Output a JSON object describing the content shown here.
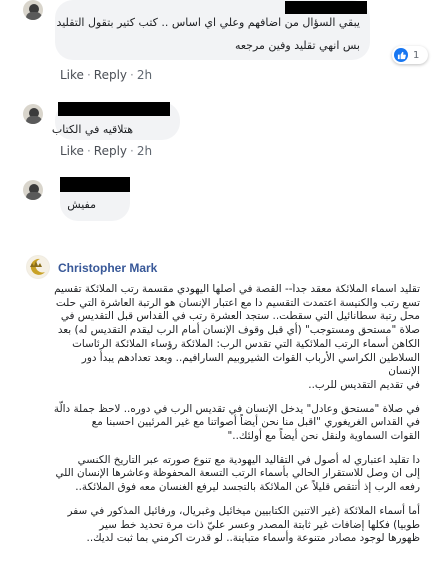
{
  "comments": [
    {
      "author_redacted": true,
      "lines": [
        "يبقي السؤال من اضافهم وعلي اي اساس .. كتب كتير بتقول التقليد",
        "بس انهي تقليد وفين مرجعه"
      ],
      "reaction_count": "1",
      "like": "Like",
      "reply": "Reply",
      "time": "2h"
    },
    {
      "author_redacted": true,
      "lines": [
        "هتلاقيه في الكتاب"
      ],
      "like": "Like",
      "reply": "Reply",
      "time": "2h"
    },
    {
      "author_redacted": true,
      "lines": [
        "مفيش"
      ]
    },
    {
      "author": "Christopher Mark",
      "paragraphs": [
        [
          "تقليد اسماء الملائكة معقد جداً-- القصة في أصلها اليهودي مقسمة رتب الملائكة تقسيم",
          "تسع رتب والكنيسة اعتمدت التقسيم دا مع اعتبار الإنسان هو الرتبة العاشرة التي حلت",
          "محل رتبة سطانائيل التي سقطت.. ستجد العشرة رتب في القداس قبل التقديس في",
          "صلاة \"مستحق ومستوجب\" (أي قبل وقوف الإنسان أمام الرب ليقدم التقديس له) بعد",
          "الكاهن أسماء الرتب الملائكية التي تقدس الرب: الملائكة رؤساء الملائكة الرئاسات",
          "السلاطين الكراسي الأرباب القوات الشيروبيم السارافيم.. وبعد تعدادهم يبدأ دور الإنسان",
          "في تقديم التقديس للرب.."
        ],
        [
          "في صلاة \"مستحق وعادل\" يدخل الإنسان في تقديس الرب في دوره.. لاحظ جملة دالّة",
          "في القداس الغريغوري \"اقبل منا نحن أيضاً أصواتنا مع غير المرئيين احسبنا مع",
          "القوات السماوية ولنقل نحن أيضاً مع أولئك..\""
        ],
        [
          "دا تقليد اعتباري له أصول في التقاليد اليهودية مع تنوع صورته عبر التاريخ الكنسي",
          "إلى ان وصل للاستقرار الحالي بأسماء الرتب التسعة المحفوظة وعاشرها الإنسان اللي",
          "رفعه الرب إذ أتتقص قليلاً عن الملائكة بالتجسد ليرفع الغنسان معه فوق الملائكة.."
        ],
        [
          "أما أسماء الملائكة (غير الاتنين الكتابيين ميخائيل وغبريال، ورفائيل المذكور في سفر",
          "طوبيا) فكلها إضافات غير ثابتة المصدر وعسر عليّ ذات مرة تحديد خط سير",
          "ظهورها لوجود مصادر متنوعة وأسماء متباينة.. لو قدرت اكرمني بما ثبت لديك.."
        ]
      ]
    }
  ],
  "colors": {
    "link_blue": "#385898",
    "bubble_bg": "#f2f3f5",
    "meta_gray": "#606770",
    "like_blue": "#1877f2"
  }
}
